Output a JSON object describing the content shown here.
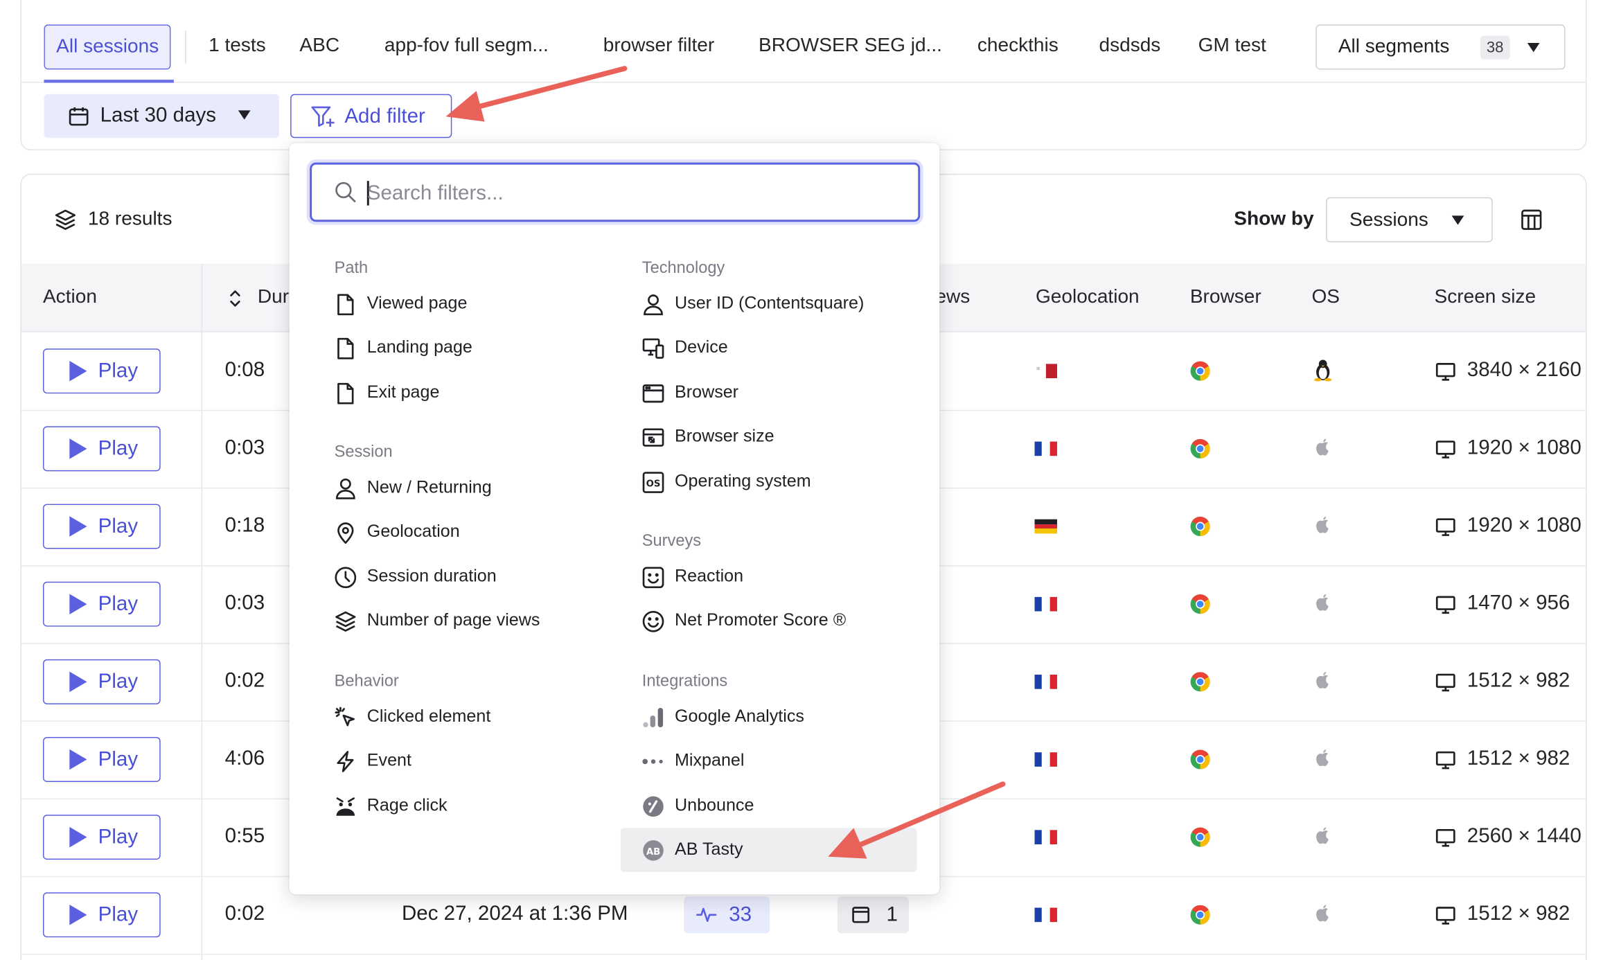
{
  "segments": {
    "tabs": [
      "All sessions",
      "1 tests",
      "ABC",
      "app-fov full segm...",
      "browser filter",
      "BROWSER SEG jd...",
      "checkthis",
      "dsdsds",
      "GM test"
    ],
    "all_label": "All segments",
    "all_count": "38"
  },
  "filters_bar": {
    "date_label": "Last 30 days",
    "add_filter_label": "Add filter"
  },
  "results": {
    "count_label": "18 results",
    "show_by_label": "Show by",
    "show_by_value": "Sessions"
  },
  "table": {
    "headers": [
      "Action",
      "Dur",
      "ews",
      "Geolocation",
      "Browser",
      "OS",
      "Screen size"
    ],
    "play_label": "Play",
    "rows": [
      {
        "duration": "0:08",
        "flag": "mt",
        "os": "linux",
        "screen": "3840 × 2160"
      },
      {
        "duration": "0:03",
        "flag": "fr",
        "os": "apple",
        "screen": "1920 × 1080"
      },
      {
        "duration": "0:18",
        "flag": "de",
        "os": "apple",
        "screen": "1920 × 1080"
      },
      {
        "duration": "0:03",
        "flag": "fr",
        "os": "apple",
        "screen": "1470 × 956"
      },
      {
        "duration": "0:02",
        "flag": "fr",
        "os": "apple",
        "screen": "1512 × 982"
      },
      {
        "duration": "4:06",
        "flag": "fr",
        "os": "apple",
        "screen": "1512 × 982"
      },
      {
        "duration": "0:55",
        "flag": "fr",
        "os": "apple",
        "screen": "2560 × 1440"
      },
      {
        "duration": "0:02",
        "flag": "fr",
        "os": "apple",
        "screen": "1512 × 982",
        "date": "Dec 27, 2024 at 1:36 PM",
        "page_views": "33",
        "tabs": "1"
      }
    ]
  },
  "dropdown": {
    "search_placeholder": "Search filters...",
    "sections": {
      "path": {
        "title": "Path",
        "items": [
          "Viewed page",
          "Landing page",
          "Exit page"
        ]
      },
      "session": {
        "title": "Session",
        "items": [
          "New / Returning",
          "Geolocation",
          "Session duration",
          "Number of page views"
        ]
      },
      "behavior": {
        "title": "Behavior",
        "items": [
          "Clicked element",
          "Event",
          "Rage click"
        ]
      },
      "technology": {
        "title": "Technology",
        "items": [
          "User ID (Contentsquare)",
          "Device",
          "Browser",
          "Browser size",
          "Operating system"
        ]
      },
      "surveys": {
        "title": "Surveys",
        "items": [
          "Reaction",
          "Net Promoter Score ®"
        ]
      },
      "integrations": {
        "title": "Integrations",
        "items": [
          "Google Analytics",
          "Mixpanel",
          "Unbounce",
          "AB Tasty"
        ]
      }
    }
  },
  "colors": {
    "accent": "#5b60e0",
    "accent_bg": "#e8ebfb",
    "annotation_arrow": "#e9625a"
  }
}
